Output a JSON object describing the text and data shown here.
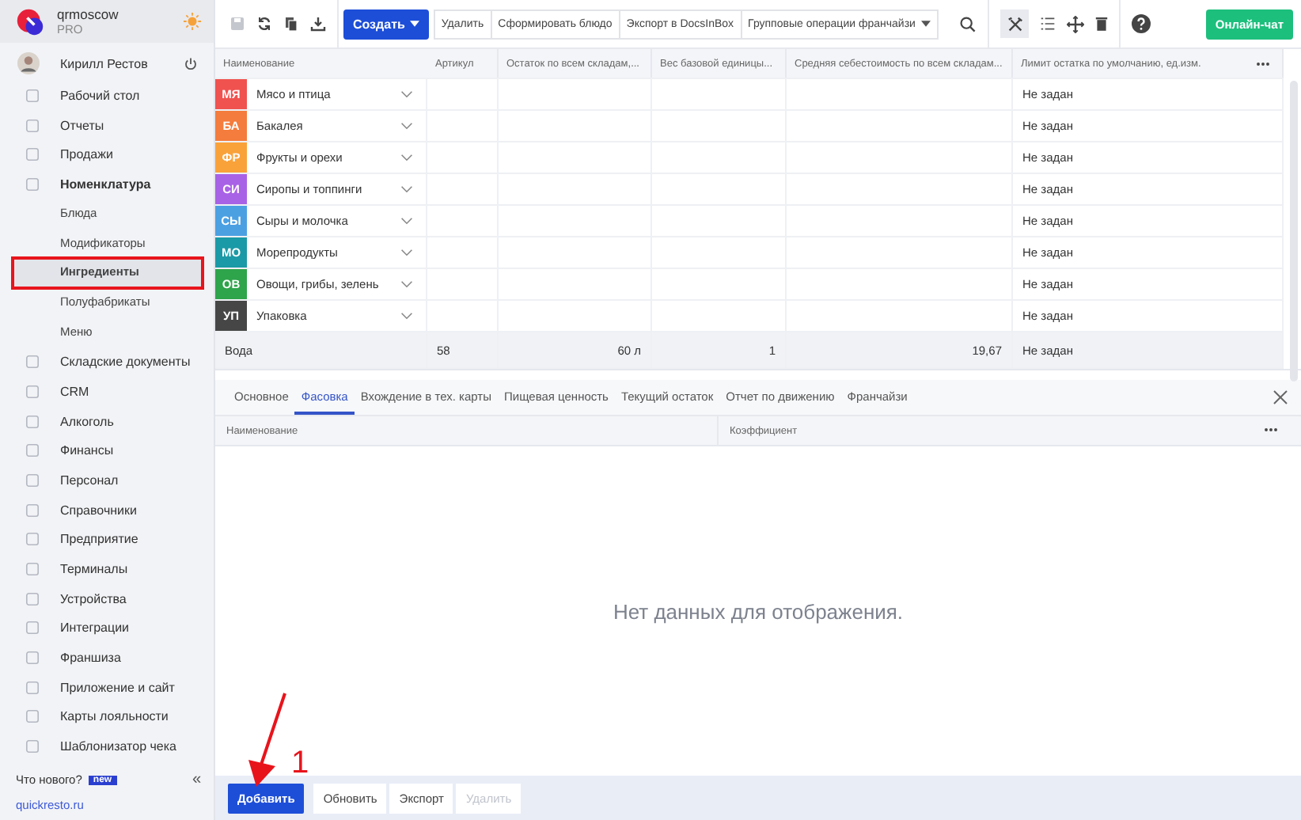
{
  "account": {
    "name": "qrmoscow",
    "plan": "PRO"
  },
  "user": {
    "name": "Кирилл Рестов"
  },
  "nav": [
    {
      "label": "Рабочий стол",
      "kind": "item",
      "selected": false,
      "expanded": false
    },
    {
      "label": "Отчеты",
      "kind": "item",
      "selected": false,
      "expanded": false
    },
    {
      "label": "Продажи",
      "kind": "item",
      "selected": false,
      "expanded": false
    },
    {
      "label": "Номенклатура",
      "kind": "item",
      "selected": false,
      "expanded": true
    },
    {
      "label": "Блюда",
      "kind": "sub",
      "selected": false
    },
    {
      "label": "Модификаторы",
      "kind": "sub",
      "selected": false
    },
    {
      "label": "Ингредиенты",
      "kind": "sub",
      "selected": true
    },
    {
      "label": "Полуфабрикаты",
      "kind": "sub",
      "selected": false
    },
    {
      "label": "Меню",
      "kind": "sub",
      "selected": false
    },
    {
      "label": "Складские документы",
      "kind": "item",
      "selected": false,
      "expanded": false
    },
    {
      "label": "CRM",
      "kind": "item",
      "selected": false,
      "expanded": false
    },
    {
      "label": "Алкоголь",
      "kind": "item",
      "selected": false,
      "expanded": false
    },
    {
      "label": "Финансы",
      "kind": "item",
      "selected": false,
      "expanded": false
    },
    {
      "label": "Персонал",
      "kind": "item",
      "selected": false,
      "expanded": false
    },
    {
      "label": "Справочники",
      "kind": "item",
      "selected": false,
      "expanded": false
    },
    {
      "label": "Предприятие",
      "kind": "item",
      "selected": false,
      "expanded": false
    },
    {
      "label": "Терминалы",
      "kind": "item",
      "selected": false,
      "expanded": false
    },
    {
      "label": "Устройства",
      "kind": "item",
      "selected": false,
      "expanded": false
    },
    {
      "label": "Интеграции",
      "kind": "item",
      "selected": false,
      "expanded": false
    },
    {
      "label": "Франшиза",
      "kind": "item",
      "selected": false,
      "expanded": false
    },
    {
      "label": "Приложение и сайт",
      "kind": "item",
      "selected": false,
      "expanded": false
    },
    {
      "label": "Карты лояльности",
      "kind": "item",
      "selected": false,
      "expanded": false
    },
    {
      "label": "Шаблонизатор чека",
      "kind": "item",
      "selected": false,
      "expanded": false
    }
  ],
  "whats_new": {
    "label": "Что нового?",
    "badge": "new"
  },
  "collapse": "«",
  "site_link": "quickresto.ru",
  "toolbar": {
    "create": "Создать",
    "actions": [
      "Удалить",
      "Сформировать блюдо",
      "Экспорт в DocsInBox"
    ],
    "dropdown": "Групповые операции франчайзи",
    "chat": "Онлайн-чат"
  },
  "table": {
    "columns": [
      "Наименование",
      "Артикул",
      "Остаток по всем складам,...",
      "Вес базовой единицы...",
      "Средняя себестоимость по всем складам...",
      "Лимит остатка по умолчанию, ед.изм."
    ],
    "groups": [
      {
        "abbr": "МЯ",
        "name": "Мясо и птица",
        "color": "#f0524f",
        "limit": "Не задан"
      },
      {
        "abbr": "БА",
        "name": "Бакалея",
        "color": "#f47c3c",
        "limit": "Не задан"
      },
      {
        "abbr": "ФР",
        "name": "Фрукты и орехи",
        "color": "#f9a23a",
        "limit": "Не задан"
      },
      {
        "abbr": "СИ",
        "name": "Сиропы и топпинги",
        "color": "#a862e6",
        "limit": "Не задан"
      },
      {
        "abbr": "СЫ",
        "name": "Сыры и молочка",
        "color": "#4ba0e2",
        "limit": "Не задан"
      },
      {
        "abbr": "МО",
        "name": "Морепродукты",
        "color": "#1a9aa6",
        "limit": "Не задан"
      },
      {
        "abbr": "ОВ",
        "name": "Овощи, грибы, зелень",
        "color": "#2ea44b",
        "limit": "Не задан"
      },
      {
        "abbr": "УП",
        "name": "Упаковка",
        "color": "#464646",
        "limit": "Не задан"
      }
    ],
    "rows": [
      {
        "cells": [
          "Вода",
          "58",
          "60 л",
          "1",
          "19,67",
          "Не задан"
        ],
        "selected": true
      }
    ]
  },
  "detail_tabs": [
    {
      "label": "Основное",
      "selected": false
    },
    {
      "label": "Фасовка",
      "selected": true
    },
    {
      "label": "Вхождение в тех. карты",
      "selected": false
    },
    {
      "label": "Пищевая ценность",
      "selected": false
    },
    {
      "label": "Текущий остаток",
      "selected": false
    },
    {
      "label": "Отчет по движению",
      "selected": false
    },
    {
      "label": "Франчайзи",
      "selected": false
    }
  ],
  "detail_table": {
    "columns": [
      "Наименование",
      "Коэффициент"
    ],
    "empty_message": "Нет данных для отображения."
  },
  "bottom_buttons": [
    {
      "label": "Добавить",
      "kind": "primary",
      "disabled": false
    },
    {
      "label": "Обновить",
      "kind": "plain",
      "disabled": false
    },
    {
      "label": "Экспорт",
      "kind": "plain",
      "disabled": false
    },
    {
      "label": "Удалить",
      "kind": "plain",
      "disabled": true
    }
  ],
  "annotation": {
    "label": "1"
  }
}
